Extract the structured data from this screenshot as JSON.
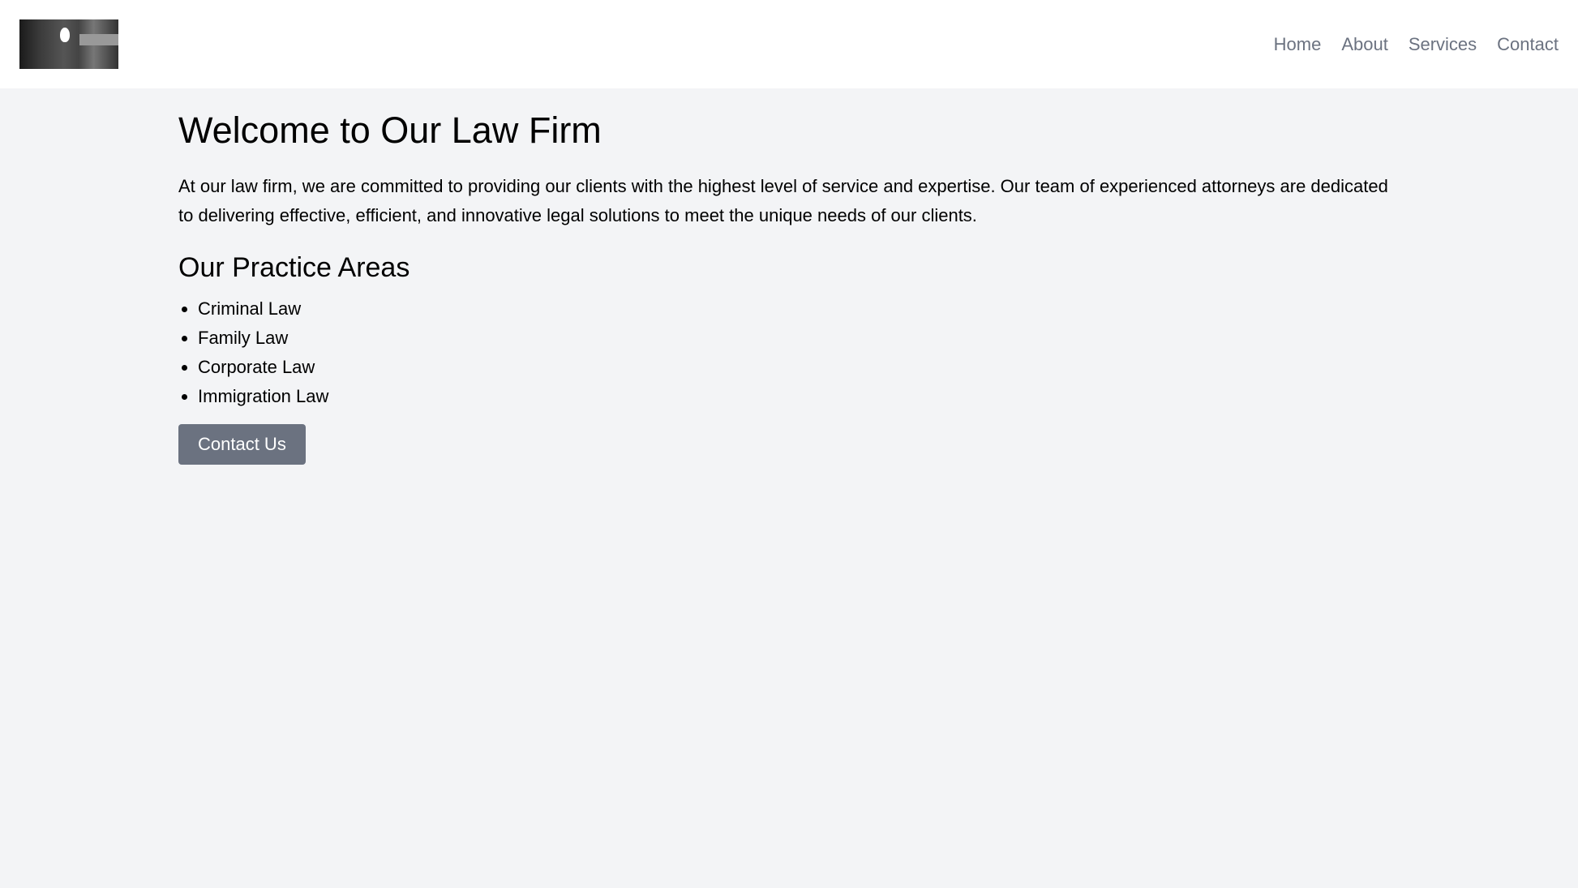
{
  "header": {
    "logo_alt": "Law firm logo",
    "nav": [
      {
        "label": "Home"
      },
      {
        "label": "About"
      },
      {
        "label": "Services"
      },
      {
        "label": "Contact"
      }
    ]
  },
  "main": {
    "title": "Welcome to Our Law Firm",
    "intro": "At our law firm, we are committed to providing our clients with the highest level of service and expertise. Our team of experienced attorneys are dedicated to delivering effective, efficient, and innovative legal solutions to meet the unique needs of our clients.",
    "practice_heading": "Our Practice Areas",
    "practice_areas": [
      "Criminal Law",
      "Family Law",
      "Corporate Law",
      "Immigration Law"
    ],
    "cta_label": "Contact Us"
  },
  "colors": {
    "background": "#f3f4f6",
    "header_bg": "#ffffff",
    "nav_text": "#6b7280",
    "button_bg": "#6b7280",
    "button_text": "#ffffff"
  }
}
